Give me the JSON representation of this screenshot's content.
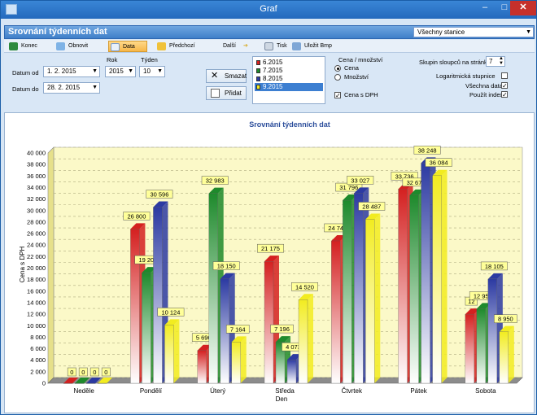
{
  "window": {
    "title": "Graf",
    "min_glyph": "–",
    "max_glyph": "□",
    "close_glyph": "✕"
  },
  "header": {
    "title": "Srovnání týdenních dat",
    "station": "Všechny stanice"
  },
  "toolbar": {
    "konec": "Konec",
    "obnovit": "Obnovit",
    "data": "Data",
    "predchozi": "Předchozí",
    "dalsi": "Další",
    "tisk": "Tisk",
    "ulozit": "Uložit Bmp"
  },
  "controls": {
    "datum_od_label": "Datum od",
    "datum_od": "1.   2. 2015",
    "datum_do_label": "Datum do",
    "datum_do": "28.  2. 2015",
    "rok_label": "Rok",
    "rok": "2015",
    "tyden_label": "Týden",
    "tyden": "10",
    "smazat": "Smazat",
    "pridat": "Přidat",
    "periods": [
      {
        "label": "6.2015",
        "color": "#d42020"
      },
      {
        "label": "7.2015",
        "color": "#1e8a2c"
      },
      {
        "label": "8.2015",
        "color": "#2c3aa2"
      },
      {
        "label": "9.2015",
        "color": "#f2ec20"
      }
    ],
    "cena_mnozstvi_label": "Cena / množství",
    "cena": "Cena",
    "mnozstvi": "Množství",
    "cena_dph": "Cena s DPH",
    "skupin_label": "Skupin sloupců na stránku",
    "skupin": "7",
    "log_label": "Logaritmická stupnice",
    "vsechna_label": "Všechna data",
    "index_label": "Použít index"
  },
  "chart_data": {
    "type": "bar",
    "title": "Srovnání týdenních dat",
    "xlabel": "Den",
    "ylabel": "Cena s DPH",
    "ylim": [
      0,
      40000
    ],
    "yticks": [
      "0",
      "2 000",
      "4 000",
      "6 000",
      "8 000",
      "10 000",
      "12 000",
      "14 000",
      "16 000",
      "18 000",
      "20 000",
      "22 000",
      "24 000",
      "26 000",
      "28 000",
      "30 000",
      "32 000",
      "34 000",
      "36 000",
      "38 000",
      "40 000"
    ],
    "categories": [
      "Neděle",
      "Pondělí",
      "Úterý",
      "Středa",
      "Čtvrtek",
      "Pátek",
      "Sobota"
    ],
    "grid": true,
    "series": [
      {
        "name": "6.2015",
        "color": "#d42020",
        "values": [
          0,
          26800,
          5696,
          21175,
          24740,
          33736,
          12000
        ]
      },
      {
        "name": "7.2015",
        "color": "#1e8a2c",
        "values": [
          0,
          19202,
          32983,
          7196,
          31796,
          32670,
          12952
        ]
      },
      {
        "name": "8.2015",
        "color": "#2c3aa2",
        "values": [
          0,
          30596,
          18150,
          4073,
          33027,
          38248,
          18105
        ]
      },
      {
        "name": "9.2015",
        "color": "#f2ec20",
        "values": [
          0,
          10124,
          7164,
          14520,
          28487,
          36084,
          8950
        ]
      }
    ],
    "value_labels": [
      [
        "0",
        "26 800",
        "5 696",
        "21 175",
        "24 740",
        "33 736",
        "12"
      ],
      [
        "0",
        "19 202",
        "32 983",
        "7 196",
        "31 796",
        "32 670",
        "12 952"
      ],
      [
        "0",
        "30 596",
        "18 150",
        "4 073",
        "33 027",
        "38 248",
        "18 105"
      ],
      [
        "0",
        "10 124",
        "7 164",
        "14 520",
        "28 487",
        "36 084",
        "8 950"
      ]
    ]
  }
}
